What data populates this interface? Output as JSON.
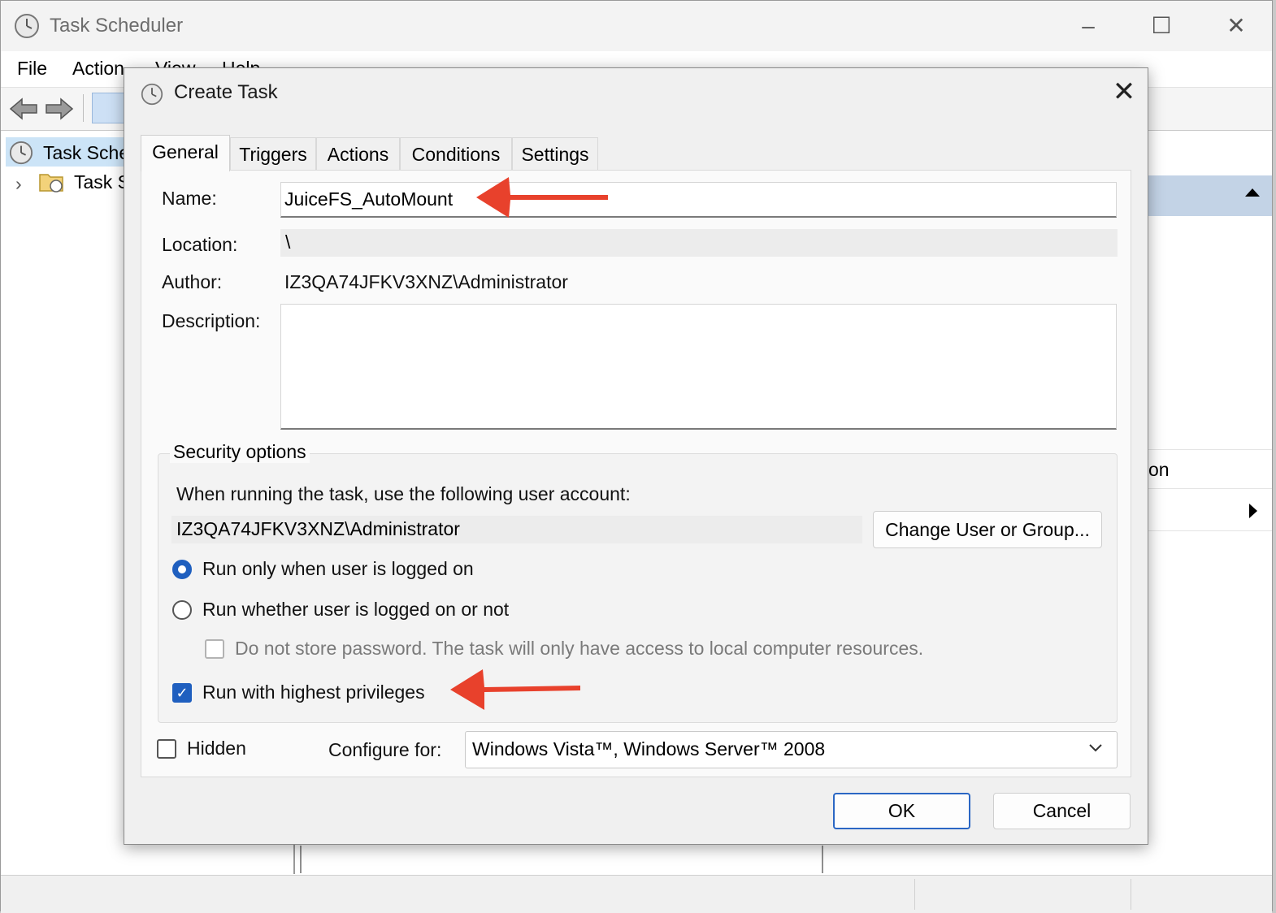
{
  "main_window": {
    "title": "Task Scheduler",
    "menu": [
      "File",
      "Action",
      "View",
      "Help"
    ],
    "tree": {
      "root_label": "Task Sche",
      "child_label": "Task S"
    },
    "right_pane_fragment": "on"
  },
  "dialog": {
    "title": "Create Task",
    "tabs": [
      "General",
      "Triggers",
      "Actions",
      "Conditions",
      "Settings"
    ],
    "active_tab": "General",
    "fields": {
      "name_label": "Name:",
      "name_value": "JuiceFS_AutoMount",
      "location_label": "Location:",
      "location_value": "\\",
      "author_label": "Author:",
      "author_value": "IZ3QA74JFKV3XNZ\\Administrator",
      "description_label": "Description:",
      "description_value": ""
    },
    "security": {
      "legend": "Security options",
      "account_prompt": "When running the task, use the following user account:",
      "account_value": "IZ3QA74JFKV3XNZ\\Administrator",
      "change_user_button": "Change User or Group...",
      "radio_logged_on": "Run only when user is logged on",
      "radio_logged_on_checked": true,
      "radio_whether": "Run whether user is logged on or not",
      "radio_whether_checked": false,
      "no_store_password": "Do not store password.  The task will only have access to local computer resources.",
      "no_store_password_checked": false,
      "highest_privileges": "Run with highest privileges",
      "highest_privileges_checked": true
    },
    "hidden_label": "Hidden",
    "hidden_checked": false,
    "configure_for_label": "Configure for:",
    "configure_for_value": "Windows Vista™, Windows Server™ 2008",
    "ok_button": "OK",
    "cancel_button": "Cancel"
  },
  "colors": {
    "accent": "#1f5fbf",
    "annotation_arrow": "#e8412c",
    "selected_header": "#c3d3e6"
  }
}
